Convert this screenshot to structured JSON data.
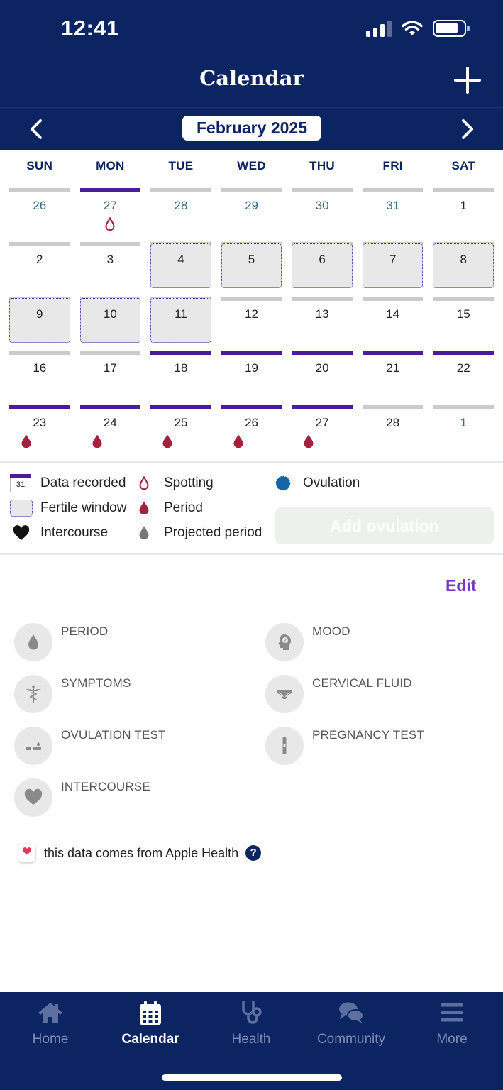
{
  "status_bar": {
    "time": "12:41"
  },
  "header": {
    "title": "Calendar",
    "month": "February 2025"
  },
  "colors": {
    "navy": "#0c2461",
    "recorded_bar": "#4b1d9c",
    "empty_bar": "#cbcbcb",
    "period": "#a3203f",
    "ovulation": "#1565a6",
    "edit": "#7a35c7"
  },
  "weekdays": [
    "SUN",
    "MON",
    "TUE",
    "WED",
    "THU",
    "FRI",
    "SAT"
  ],
  "weeks": [
    [
      {
        "num": "26",
        "other": true,
        "bar": "empty"
      },
      {
        "num": "27",
        "other": true,
        "bar": "recorded",
        "drop": "spotting"
      },
      {
        "num": "28",
        "other": true,
        "bar": "empty"
      },
      {
        "num": "29",
        "other": true,
        "bar": "empty"
      },
      {
        "num": "30",
        "other": true,
        "bar": "empty"
      },
      {
        "num": "31",
        "other": true,
        "bar": "empty"
      },
      {
        "num": "1",
        "bar": "empty"
      }
    ],
    [
      {
        "num": "2",
        "bar": "empty"
      },
      {
        "num": "3",
        "bar": "empty"
      },
      {
        "num": "4",
        "bar": "empty",
        "fertile": true
      },
      {
        "num": "5",
        "bar": "empty",
        "fertile": true
      },
      {
        "num": "6",
        "bar": "empty",
        "fertile": true
      },
      {
        "num": "7",
        "bar": "empty",
        "fertile": true
      },
      {
        "num": "8",
        "bar": "empty",
        "fertile": true
      }
    ],
    [
      {
        "num": "9",
        "bar": "empty",
        "fertile": true
      },
      {
        "num": "10",
        "bar": "empty",
        "fertile": true
      },
      {
        "num": "11",
        "bar": "empty",
        "fertile": true
      },
      {
        "num": "12",
        "bar": "empty"
      },
      {
        "num": "13",
        "bar": "empty"
      },
      {
        "num": "14",
        "bar": "empty"
      },
      {
        "num": "15",
        "bar": "empty"
      }
    ],
    [
      {
        "num": "16",
        "bar": "empty"
      },
      {
        "num": "17",
        "bar": "empty"
      },
      {
        "num": "18",
        "bar": "recorded"
      },
      {
        "num": "19",
        "bar": "recorded"
      },
      {
        "num": "20",
        "bar": "recorded"
      },
      {
        "num": "21",
        "bar": "recorded"
      },
      {
        "num": "22",
        "bar": "recorded"
      }
    ],
    [
      {
        "num": "23",
        "bar": "recorded",
        "drop": "period"
      },
      {
        "num": "24",
        "bar": "recorded",
        "drop": "period"
      },
      {
        "num": "25",
        "bar": "recorded",
        "drop": "period"
      },
      {
        "num": "26",
        "bar": "recorded",
        "drop": "period"
      },
      {
        "num": "27",
        "bar": "recorded",
        "drop": "period"
      },
      {
        "num": "28",
        "bar": "empty"
      },
      {
        "num": "1",
        "other": true,
        "bar": "empty"
      }
    ]
  ],
  "legend": {
    "data_recorded": "Data recorded",
    "calendar_icon_day": "31",
    "fertile_window": "Fertile window",
    "intercourse": "Intercourse",
    "spotting": "Spotting",
    "period": "Period",
    "projected_period": "Projected period",
    "ovulation": "Ovulation",
    "add_ovulation": "Add ovulation"
  },
  "edit_label": "Edit",
  "categories": [
    {
      "name": "period",
      "label": "PERIOD",
      "icon": "drop-icon"
    },
    {
      "name": "mood",
      "label": "MOOD",
      "icon": "head-icon"
    },
    {
      "name": "symptoms",
      "label": "SYMPTOMS",
      "icon": "caduceus-icon"
    },
    {
      "name": "cervical-fluid",
      "label": "CERVICAL FLUID",
      "icon": "underwear-icon"
    },
    {
      "name": "ovulation-test",
      "label": "OVULATION TEST",
      "icon": "test-strip-icon"
    },
    {
      "name": "pregnancy-test",
      "label": "PREGNANCY TEST",
      "icon": "pregnancy-test-icon"
    },
    {
      "name": "intercourse",
      "label": "INTERCOURSE",
      "icon": "heart-icon"
    }
  ],
  "apple_health_note": "this data comes from Apple Health",
  "tabs": [
    {
      "label": "Home",
      "icon": "home-icon",
      "active": false
    },
    {
      "label": "Calendar",
      "icon": "calendar-icon",
      "active": true
    },
    {
      "label": "Health",
      "icon": "stethoscope-icon",
      "active": false
    },
    {
      "label": "Community",
      "icon": "chat-bubbles-icon",
      "active": false
    },
    {
      "label": "More",
      "icon": "menu-icon",
      "active": false
    }
  ]
}
